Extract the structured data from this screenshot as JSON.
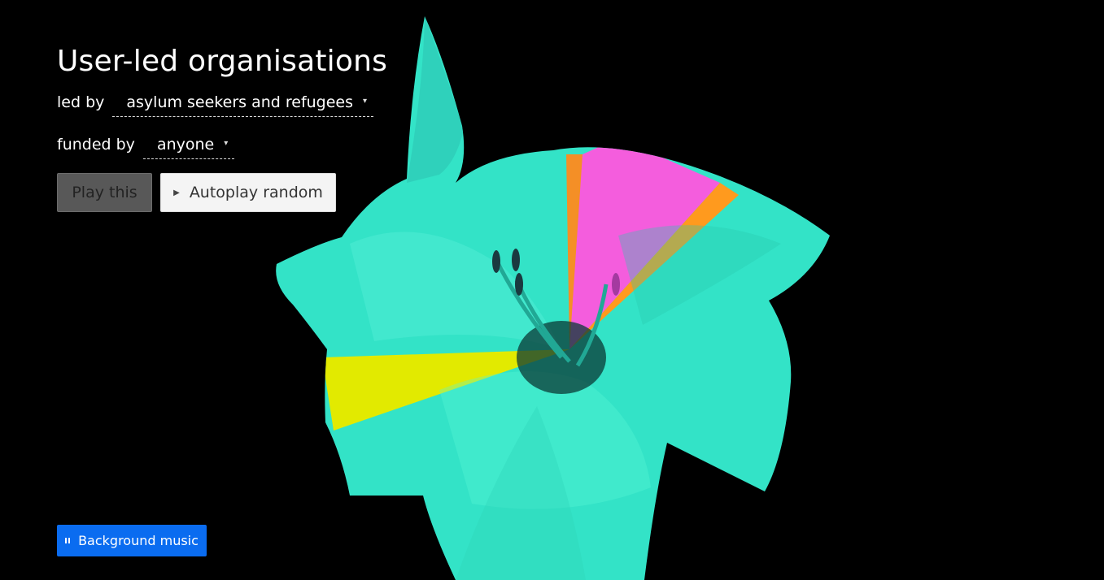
{
  "title": "User-led organisations",
  "filters": {
    "led_by": {
      "label": "led by",
      "value": "asylum seekers and refugees",
      "icon": "caret-down-icon"
    },
    "funded_by": {
      "label": "funded by",
      "value": "anyone",
      "icon": "caret-down-icon"
    }
  },
  "buttons": {
    "play_this": "Play this",
    "autoplay_random": "Autoplay random",
    "autoplay_icon": "play-icon"
  },
  "music": {
    "label": "Background music",
    "icon": "pause-icon"
  },
  "colors": {
    "background": "#000000",
    "flower": "#35e6c8",
    "wedge_magenta": "#f45ddd",
    "wedge_orange": "#ff8a1e",
    "wedge_yellow": "#e2ea00",
    "music_button": "#0a6cf0"
  }
}
